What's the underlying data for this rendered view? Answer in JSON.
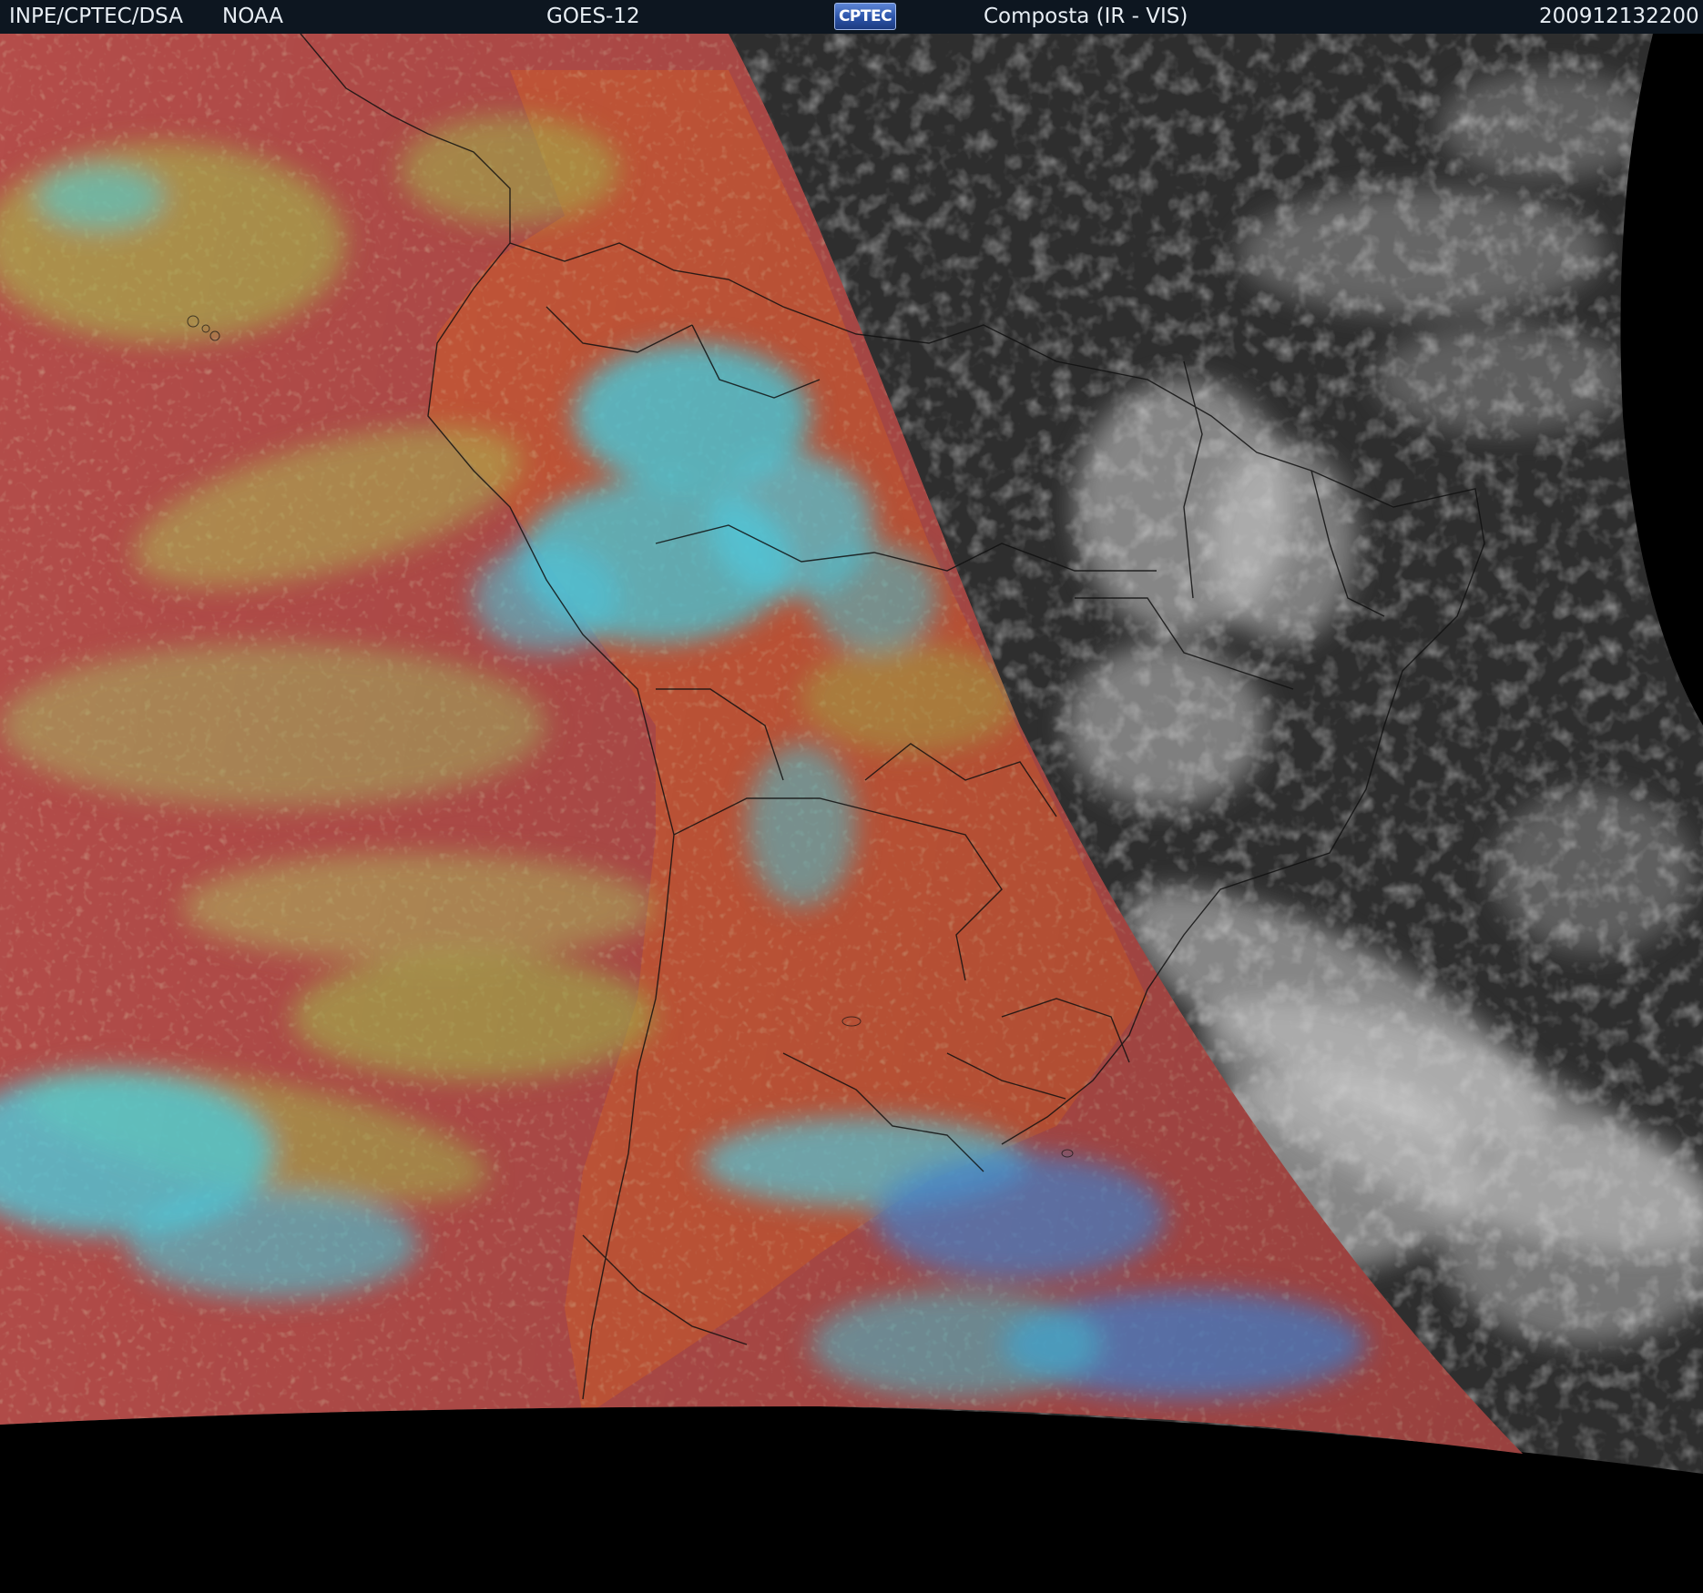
{
  "header": {
    "institution": "INPE/CPTEC/DSA",
    "agency": "NOAA",
    "satellite": "GOES-12",
    "logo_text": "CPTEC",
    "product": "Composta (IR - VIS)",
    "timestamp": "200912132200"
  },
  "colors": {
    "header_background": "#0d1620",
    "header_text": "#e8eef4",
    "ir_warm_surface": "#b44d4a",
    "ir_land_surface": "#c8583a",
    "ir_mid_cloud": "#a8c050",
    "ir_high_cloud": "#4ad6e8",
    "ir_cold_cloud_blue": "#4a8ee0",
    "vis_dark_surface": "#2e2e2e",
    "vis_cloud": "#d0d0d0",
    "space": "#000000"
  }
}
